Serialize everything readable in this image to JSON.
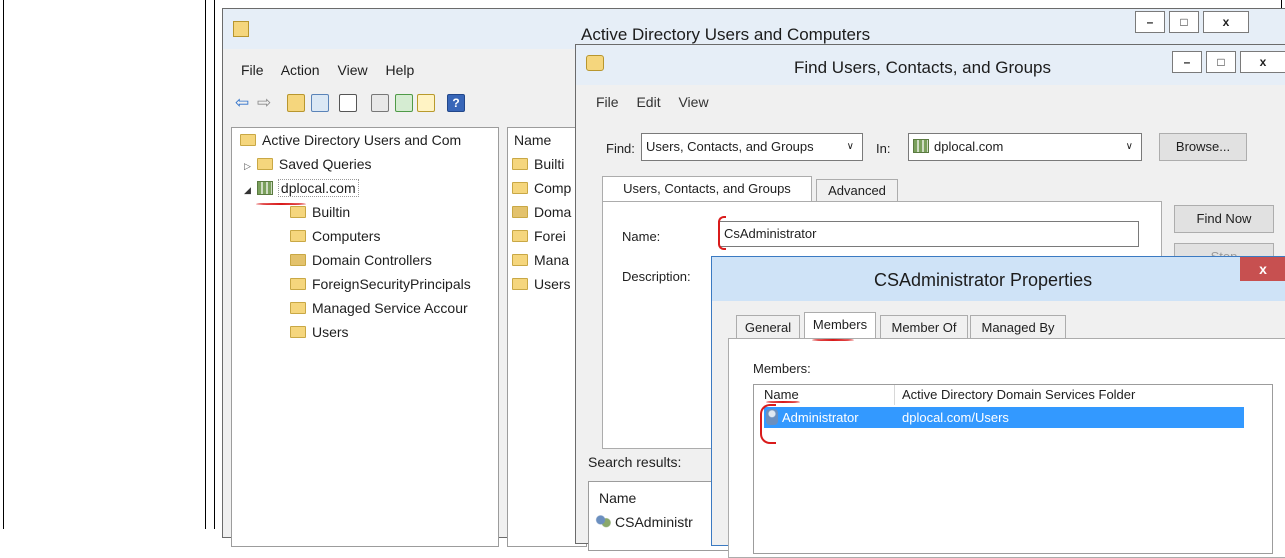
{
  "aduc": {
    "title": "Active Directory Users and Computers",
    "menu": [
      "File",
      "Action",
      "View",
      "Help"
    ],
    "tree": {
      "root": "Active Directory Users and Com",
      "saved_queries": "Saved Queries",
      "domain": "dplocal.com",
      "children": [
        "Builtin",
        "Computers",
        "Domain Controllers",
        "ForeignSecurityPrincipals",
        "Managed Service Accour",
        "Users"
      ]
    },
    "list": {
      "header": "Name",
      "items": [
        "Builti",
        "Comp",
        "Doma",
        "Forei",
        "Mana",
        "Users"
      ]
    },
    "controls": {
      "minimize": "–",
      "maximize": "□",
      "close": "x"
    }
  },
  "find": {
    "title": "Find Users, Contacts, and Groups",
    "menu": [
      "File",
      "Edit",
      "View"
    ],
    "find_label": "Find:",
    "find_value": "Users, Contacts, and Groups",
    "in_label": "In:",
    "in_value": "dplocal.com",
    "browse": "Browse...",
    "tabs": [
      "Users, Contacts, and Groups",
      "Advanced"
    ],
    "name_label": "Name:",
    "name_value": "CsAdministrator",
    "description_label": "Description:",
    "find_now": "Find Now",
    "stop": "Stop",
    "search_results": "Search results:",
    "results_header": "Name",
    "results": [
      "CSAdministr"
    ],
    "controls": {
      "minimize": "–",
      "maximize": "□",
      "close": "x"
    }
  },
  "props": {
    "title": "CSAdministrator Properties",
    "close": "x",
    "tabs": [
      "General",
      "Members",
      "Member Of",
      "Managed By"
    ],
    "members_label": "Members:",
    "columns": [
      "Name",
      "Active Directory Domain Services Folder"
    ],
    "rows": [
      {
        "name": "Administrator",
        "folder": "dplocal.com/Users"
      }
    ],
    "selection_color": "#3399ff",
    "close_color": "#c75050"
  }
}
